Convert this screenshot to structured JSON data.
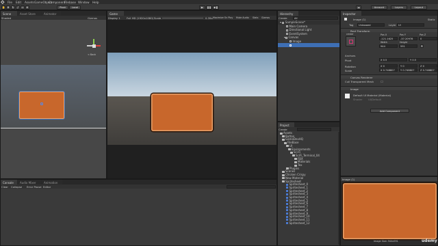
{
  "menu": [
    "File",
    "Edit",
    "Assets",
    "GameObject",
    "Component",
    "Filebase",
    "Window",
    "Help"
  ],
  "toolbar": {
    "pivot": "Pivot",
    "local": "Local",
    "account": "Account",
    "layers": "Layers",
    "layout": "Layout"
  },
  "left_tabs": [
    "Scene",
    "Asset Store",
    "Animator"
  ],
  "scene": {
    "shading": "Shaded",
    "gizmos": "Gizmos",
    "axis_label": "< Back"
  },
  "game": {
    "tab": "Game",
    "display": "Display 1",
    "resolution": "Full HD (1920x1080)",
    "scale_label": "Scale",
    "scale_value": "0.39x",
    "options": [
      "Maximize On Play",
      "Mute Audio",
      "Stats",
      "Gizmos"
    ]
  },
  "hierarchy": {
    "tab": "Hierarchy",
    "create": "Create",
    "search_placeholder": "All",
    "items": [
      "SampleScene*",
      "Main Camera",
      "Directional Light",
      "EventSystem",
      "Canvas",
      "Image"
    ]
  },
  "inspector": {
    "tab": "Inspector",
    "object_name": "Image (1)",
    "static": "Static",
    "tag_label": "Tag",
    "tag_value": "Untagged",
    "layer_label": "Layer",
    "layer_value": "UI",
    "rect_transform": "Rect Transform",
    "anchor_preset": "center",
    "pos_x_label": "Pos X",
    "pos_x": "-121.1625",
    "pos_y_label": "Pos Y",
    "pos_y": "-37.20978",
    "pos_z_label": "Pos Z",
    "pos_z": "0",
    "width_label": "Width",
    "width": "944",
    "height_label": "Height",
    "height": "591",
    "anchors": "Anchors",
    "pivot_label": "Pivot",
    "pivot_x": "X  0.5",
    "pivot_y": "Y  0.5",
    "rotation_label": "Rotation",
    "rot_x": "X  0",
    "rot_y": "Y  0",
    "rot_z": "Z  0",
    "scale_label": "Scale",
    "scale_x": "X  0.748807",
    "scale_y": "Y  0.748807",
    "scale_z": "Z  0.748807",
    "canvas_renderer": "Canvas Renderer",
    "cull_mesh": "Cull Transparent Mesh",
    "image_component": "Image",
    "material": "Default UI Material (Material)",
    "shader_label": "Shader",
    "shader_value": "UI/Default",
    "add_component": "Add Component",
    "preview_title": "Image (1)",
    "preview_size": "Image Size: 944x591"
  },
  "project": {
    "tab": "Project",
    "create": "Create",
    "tree": [
      {
        "label": "Assets",
        "indent": 1
      },
      {
        "label": "Button",
        "indent": 2
      },
      {
        "label": "GameDevHQ",
        "indent": 2
      },
      {
        "label": "FileBase",
        "indent": 3
      },
      {
        "label": "UI",
        "indent": 4
      },
      {
        "label": "Environments",
        "indent": 5
      },
      {
        "label": "Sci-Fi",
        "indent": 6
      },
      {
        "label": "SciFi_Terminal_04",
        "indent": 7
      },
      {
        "label": "FBX",
        "indent": 8
      },
      {
        "label": "Materials",
        "indent": 8
      },
      {
        "label": "Tex",
        "indent": 8
      },
      {
        "label": "Plugins",
        "indent": 4
      },
      {
        "label": "Scenes",
        "indent": 2
      },
      {
        "label": "Chicken Crispy",
        "indent": 2
      },
      {
        "label": "New Material",
        "indent": 2
      },
      {
        "label": "Spritesheet",
        "indent": 2
      }
    ],
    "sprites": [
      "Spritesheet_0",
      "Spritesheet_1",
      "Spritesheet_2",
      "Spritesheet_3",
      "Spritesheet_4",
      "Spritesheet_5",
      "Spritesheet_6",
      "Spritesheet_7",
      "Spritesheet_8",
      "Spritesheet_9",
      "Spritesheet_10",
      "Spritesheet_11",
      "Spritesheet_12"
    ]
  },
  "console": {
    "tabs": [
      "Console",
      "Audio Mixer",
      "Animation"
    ],
    "buttons": [
      "Clear",
      "Collapse",
      "Error Pause",
      "Editor"
    ]
  },
  "colors": {
    "accent_blue": "#3e6fb5",
    "card_orange": "#c8672c",
    "sky_blue": "#a8c4dc",
    "ground": "#4a4843"
  },
  "watermark": "udemy"
}
